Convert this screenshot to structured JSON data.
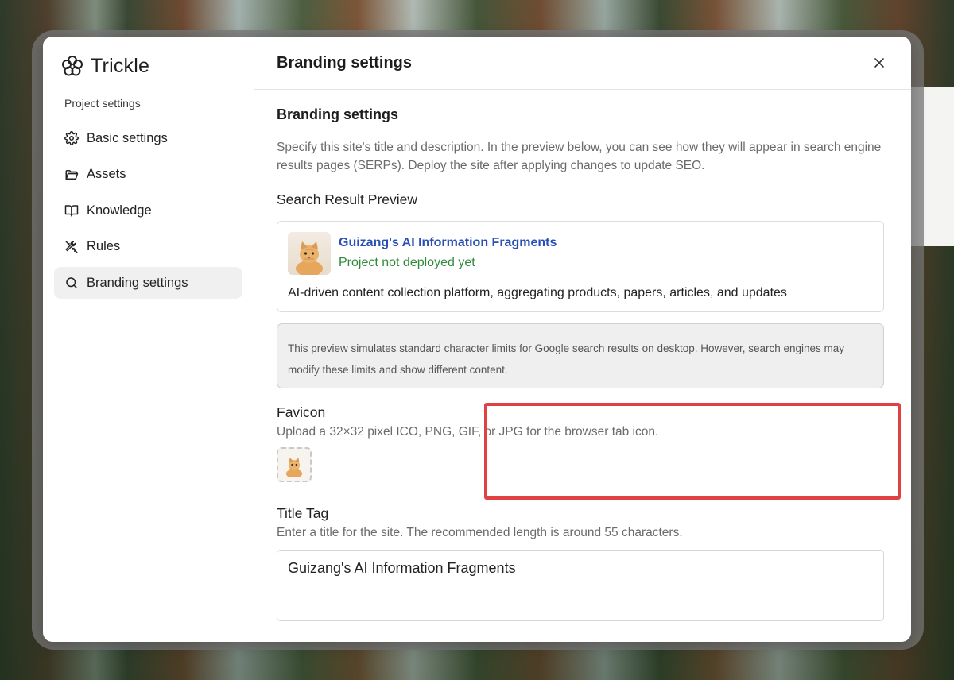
{
  "app": {
    "brand_name": "Trickle"
  },
  "sidebar": {
    "section_label": "Project settings",
    "items": [
      {
        "label": "Basic settings",
        "icon": "gear-icon",
        "active": false
      },
      {
        "label": "Assets",
        "icon": "folder-icon",
        "active": false
      },
      {
        "label": "Knowledge",
        "icon": "book-icon",
        "active": false
      },
      {
        "label": "Rules",
        "icon": "tools-icon",
        "active": false
      },
      {
        "label": "Branding settings",
        "icon": "search-icon",
        "active": true
      }
    ]
  },
  "header": {
    "title": "Branding settings",
    "close_icon": "close-icon"
  },
  "branding": {
    "section_title": "Branding settings",
    "description": "Specify this site's title and description. In the preview below, you can see how they will appear in search engine results pages (SERPs). Deploy the site after applying changes to update SEO.",
    "preview_label": "Search Result Preview",
    "result": {
      "title": "Guizang's AI Information Fragments",
      "url": "Project not deployed yet",
      "description": "AI-driven content collection platform, aggregating products, papers, articles, and updates"
    },
    "note": "This preview simulates standard character limits for Google search results on desktop. However, search engines may modify these limits and show different content."
  },
  "favicon": {
    "label": "Favicon",
    "help": "Upload a 32×32 pixel ICO, PNG, GIF, or JPG for the browser tab icon."
  },
  "title_tag": {
    "label": "Title Tag",
    "help": "Enter a title for the site. The recommended length is around 55 characters.",
    "value": "Guizang's AI Information Fragments"
  },
  "colors": {
    "highlight": "#e04244",
    "link_blue": "#2a4fb5",
    "url_green": "#2f8a3c"
  }
}
